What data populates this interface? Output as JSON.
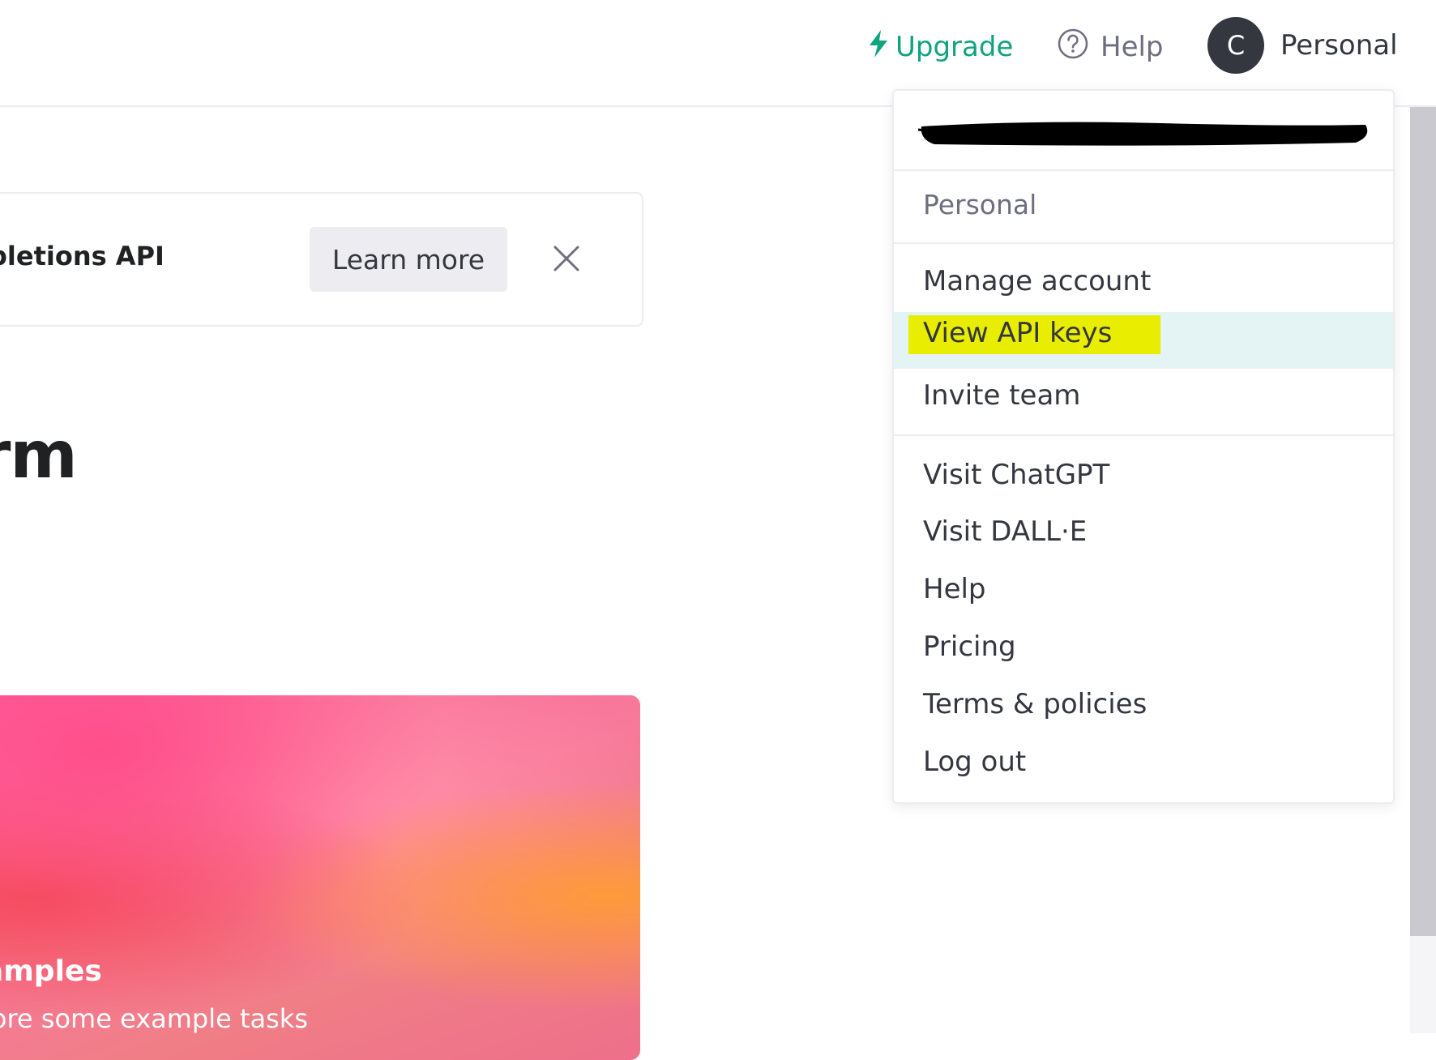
{
  "header": {
    "upgrade_label": "Upgrade",
    "help_label": "Help",
    "avatar_initial": "C",
    "account_label": "Personal"
  },
  "banner": {
    "text": "pletions API",
    "learn_more_label": "Learn more"
  },
  "hero": {
    "title": "orm"
  },
  "card": {
    "title": "amples",
    "subtitle": "lore some example tasks"
  },
  "dropdown": {
    "org_label": "Personal",
    "items": [
      {
        "label": "Manage account"
      },
      {
        "label": "View API keys"
      },
      {
        "label": "Invite team"
      },
      {
        "label": "Visit ChatGPT"
      },
      {
        "label": "Visit DALL·E"
      },
      {
        "label": "Help"
      },
      {
        "label": "Pricing"
      },
      {
        "label": "Terms & policies"
      },
      {
        "label": "Log out"
      }
    ]
  },
  "colors": {
    "accent": "#10a37f",
    "highlight": "#e9ee00",
    "active_row": "#e4f3f3",
    "avatar_bg": "#353740"
  },
  "icons": [
    "bolt-icon",
    "help-circle-icon",
    "close-icon"
  ]
}
